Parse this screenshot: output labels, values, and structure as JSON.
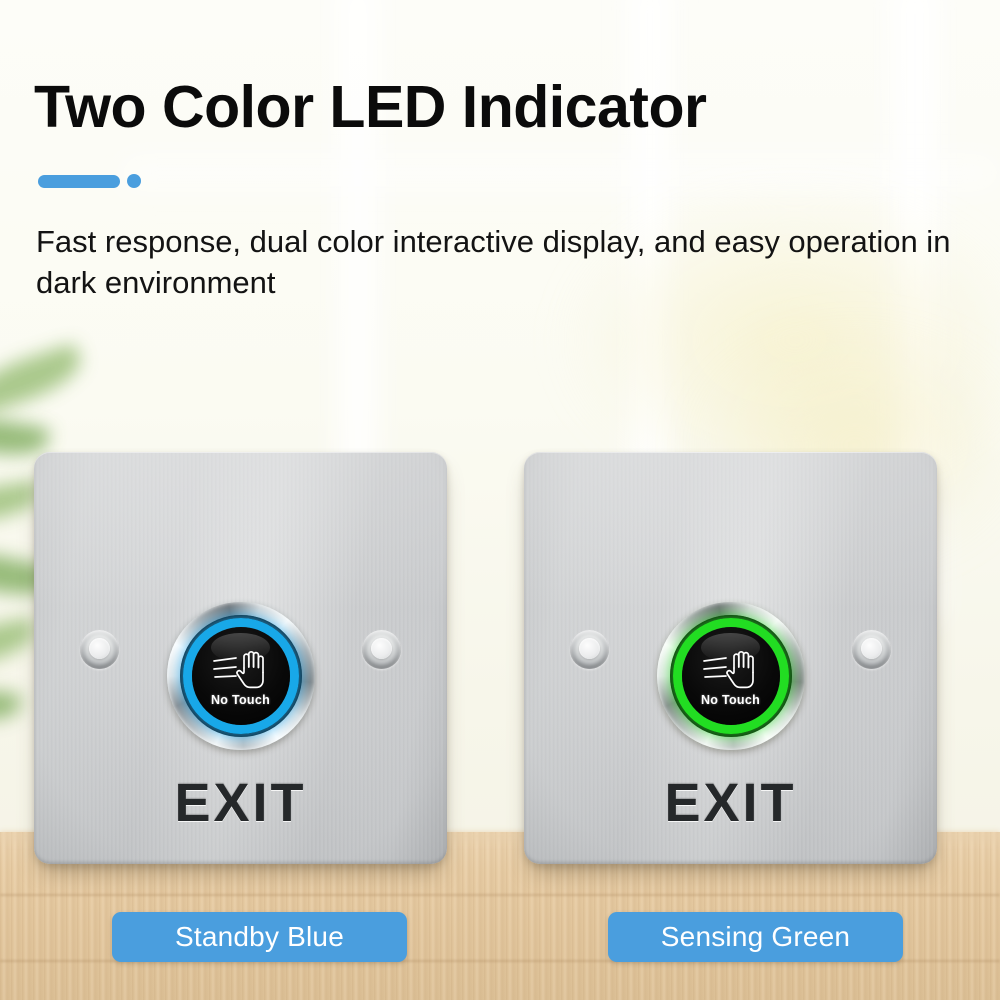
{
  "header": {
    "title": "Two Color LED Indicator",
    "subtitle": "Fast response, dual color interactive display, and easy operation in dark environment",
    "accent_color": "#4a9ede"
  },
  "product": {
    "plate_label": "EXIT",
    "button_label": "No Touch",
    "hand_icon": "no-touch-hand-icon",
    "screw_icon": "mounting-screw-icon"
  },
  "variants": [
    {
      "id": "standby-blue",
      "badge_label": "Standby Blue",
      "led_color": "#18a8e8",
      "led_glow": "#55ccff",
      "plate_label": "EXIT",
      "button_label": "No Touch"
    },
    {
      "id": "sensing-green",
      "badge_label": "Sensing Green",
      "led_color": "#22dd22",
      "led_glow": "#6cff6c",
      "plate_label": "EXIT",
      "button_label": "No Touch"
    }
  ],
  "badge_style": {
    "background": "#4a9ede",
    "text_color": "#ffffff"
  },
  "scene": {
    "surface": "wooden-desk",
    "backdrop": "blurred-bright-window",
    "plant": "blurred-green-plant-leaves"
  }
}
